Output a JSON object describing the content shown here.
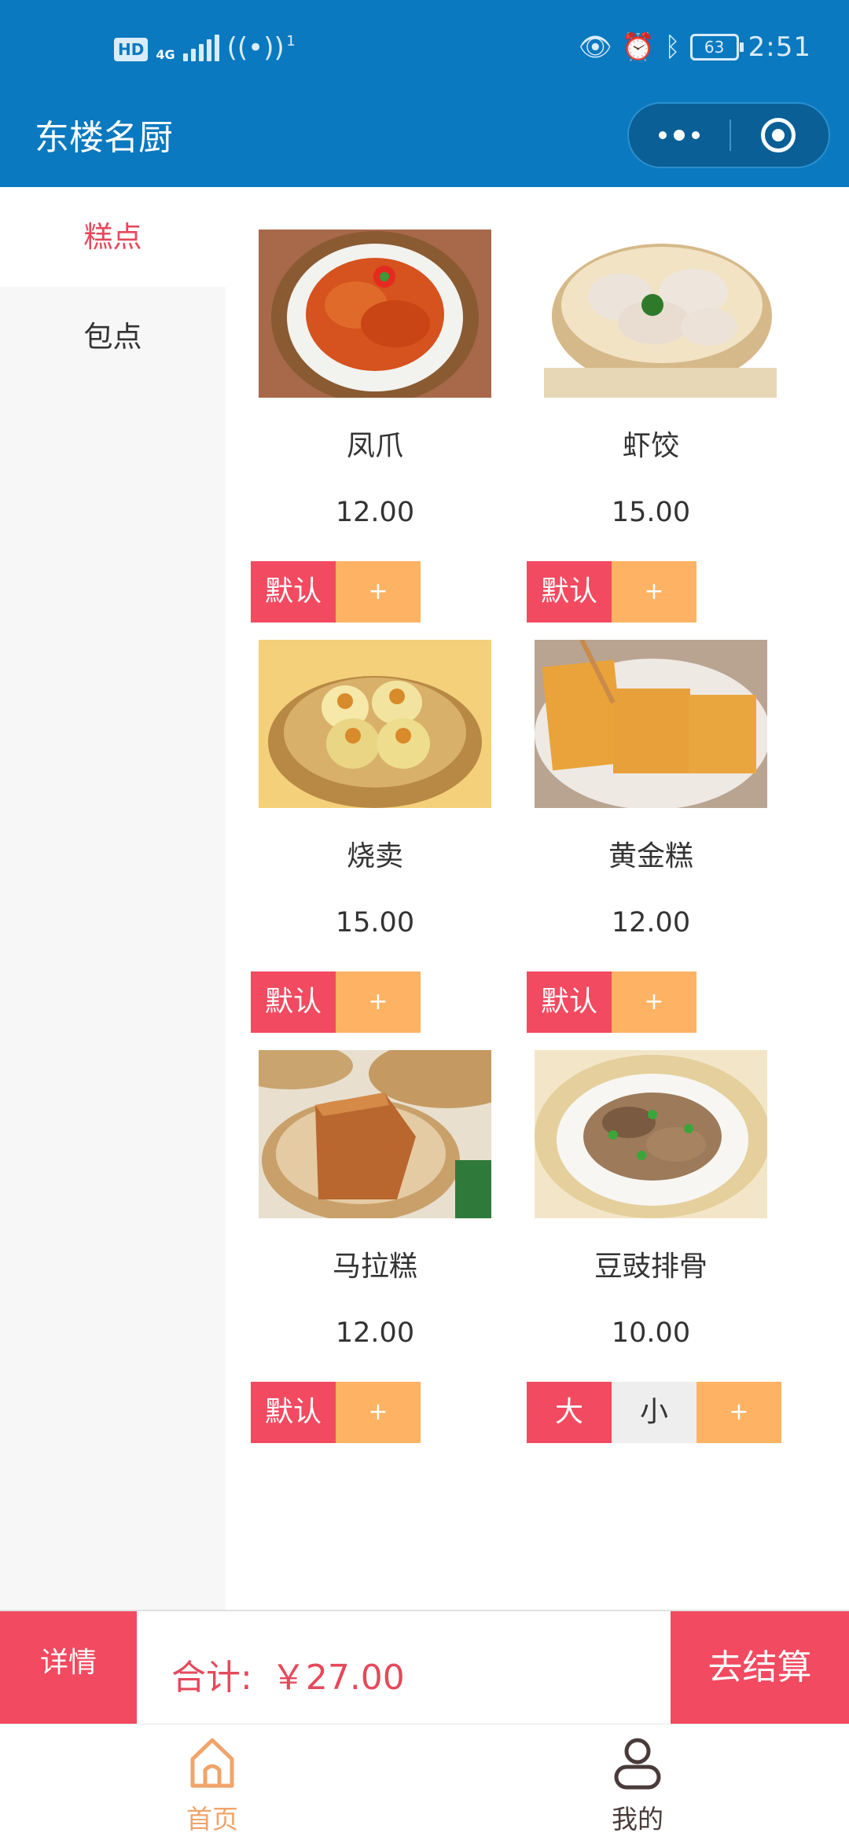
{
  "status_bar": {
    "hd": "HD",
    "network": "4G",
    "hotspot_count": "1",
    "battery": "63",
    "time": "2:51",
    "icons": [
      "eye-icon",
      "alarm-icon",
      "bluetooth-icon"
    ]
  },
  "header": {
    "title": "东楼名厨"
  },
  "sidebar": {
    "items": [
      {
        "label": "糕点",
        "active": true
      },
      {
        "label": "包点",
        "active": false
      }
    ]
  },
  "products": [
    {
      "name": "凤爪",
      "price": "12.00",
      "options": [
        "默认"
      ],
      "add": "+"
    },
    {
      "name": "虾饺",
      "price": "15.00",
      "options": [
        "默认"
      ],
      "add": "+"
    },
    {
      "name": "烧卖",
      "price": "15.00",
      "options": [
        "默认"
      ],
      "add": "+"
    },
    {
      "name": "黄金糕",
      "price": "12.00",
      "options": [
        "默认"
      ],
      "add": "+"
    },
    {
      "name": "马拉糕",
      "price": "12.00",
      "options": [
        "默认"
      ],
      "add": "+"
    },
    {
      "name": "豆豉排骨",
      "price": "10.00",
      "options": [
        "大",
        "小"
      ],
      "add": "+"
    }
  ],
  "checkout": {
    "detail_label": "详情",
    "total_label": "合计:",
    "total_value": "￥27.00",
    "pay_label": "去结算"
  },
  "tabbar": {
    "home_label": "首页",
    "mine_label": "我的"
  },
  "colors": {
    "header": "#0b79bf",
    "accent": "#f24a60",
    "plus": "#fdb363",
    "home_active": "#f0a46a"
  }
}
